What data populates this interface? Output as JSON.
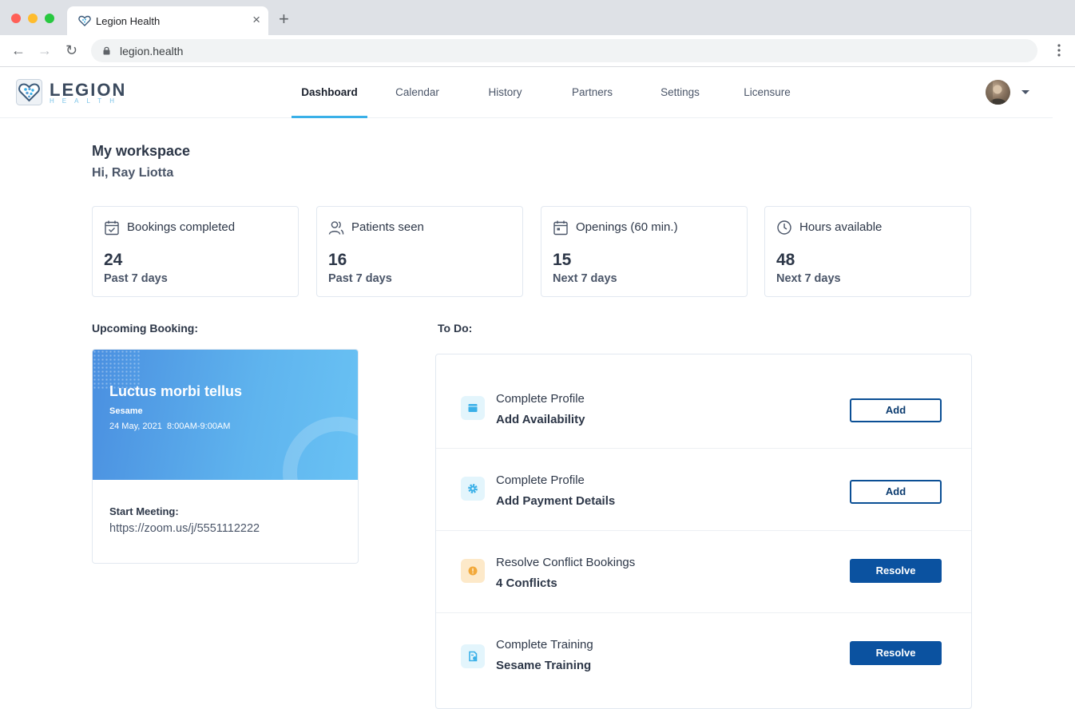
{
  "browser": {
    "tab_title": "Legion Health",
    "url": "legion.health",
    "close_glyph": "×",
    "new_tab_glyph": "+",
    "back_glyph": "←",
    "forward_glyph": "→",
    "reload_glyph": "↻"
  },
  "header": {
    "logo_word": "LEGION",
    "logo_sub": "HEALTH",
    "nav": [
      "Dashboard",
      "Calendar",
      "History",
      "Partners",
      "Settings",
      "Licensure"
    ],
    "active_nav": "Dashboard"
  },
  "workspace": {
    "title": "My workspace",
    "greeting": "Hi, Ray Liotta"
  },
  "stats": [
    {
      "icon": "calendar-check-icon",
      "label": "Bookings completed",
      "value": "24",
      "period": "Past 7 days"
    },
    {
      "icon": "users-icon",
      "label": "Patients seen",
      "value": "16",
      "period": "Past 7 days"
    },
    {
      "icon": "calendar-icon",
      "label": "Openings (60 min.)",
      "value": "15",
      "period": "Next 7 days"
    },
    {
      "icon": "clock-icon",
      "label": "Hours available",
      "value": "48",
      "period": "Next 7 days"
    }
  ],
  "upcoming": {
    "section_label": "Upcoming Booking:",
    "name": "Luctus morbi tellus",
    "org": "Sesame",
    "datetime": "24 May, 2021  8:00AM-9:00AM",
    "meeting_label": "Start Meeting:",
    "meeting_link": "https://zoom.us/j/5551112222"
  },
  "todo": {
    "section_label": "To Do:",
    "items": [
      {
        "icon": "calendar-icon",
        "title": "Complete Profile",
        "subtitle": "Add Availability",
        "button": "Add"
      },
      {
        "icon": "gear-icon",
        "title": "Complete Profile",
        "subtitle": "Add Payment Details",
        "button": "Add"
      },
      {
        "icon": "warning-icon",
        "title": "Resolve Conflict Bookings",
        "subtitle": "4 Conflicts",
        "button": "Resolve"
      },
      {
        "icon": "document-icon",
        "title": "Complete Training",
        "subtitle": "Sesame Training",
        "button": "Resolve"
      }
    ]
  },
  "colors": {
    "accent": "#3ab0e8",
    "primary_button": "#0b52a0",
    "warning": "#f2a93b"
  }
}
